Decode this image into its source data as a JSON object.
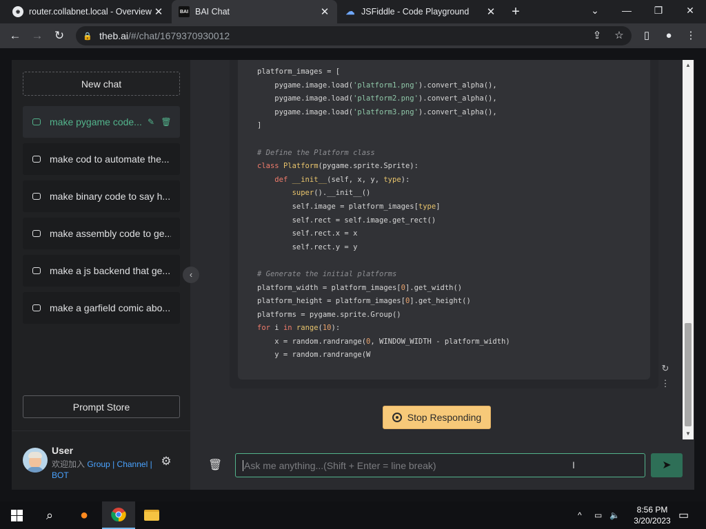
{
  "browser": {
    "tabs": [
      {
        "title": "router.collabnet.local - Overview",
        "favicon": "router-icon"
      },
      {
        "title": "BAI Chat",
        "favicon": "bai-icon",
        "favicon_text": "BAI"
      },
      {
        "title": "JSFiddle - Code Playground",
        "favicon": "jsfiddle-icon"
      }
    ],
    "url_host": "theb.ai",
    "url_path": "/#/chat/1679370930012"
  },
  "sidebar": {
    "new_chat_label": "New chat",
    "chats": [
      {
        "label": "make pygame code..."
      },
      {
        "label": "make cod to automate the..."
      },
      {
        "label": "make binary code to say h..."
      },
      {
        "label": "make assembly code to ge..."
      },
      {
        "label": "make a js backend that ge..."
      },
      {
        "label": "make a garfield comic abo..."
      }
    ],
    "prompt_store_label": "Prompt Store",
    "user": {
      "name": "User",
      "intro": "欢迎加入",
      "link_group": "Group",
      "sep": "|",
      "link_channel": "Channel",
      "link_bot": "BOT"
    }
  },
  "chat": {
    "code": [
      [
        {
          "t": "platform_images = ["
        }
      ],
      [
        {
          "t": "    pygame.image.load("
        },
        {
          "t": "'platform1.png'",
          "c": "str"
        },
        {
          "t": ").convert_alpha(),"
        }
      ],
      [
        {
          "t": "    pygame.image.load("
        },
        {
          "t": "'platform2.png'",
          "c": "str"
        },
        {
          "t": ").convert_alpha(),"
        }
      ],
      [
        {
          "t": "    pygame.image.load("
        },
        {
          "t": "'platform3.png'",
          "c": "str"
        },
        {
          "t": ").convert_alpha(),"
        }
      ],
      [
        {
          "t": "]"
        }
      ],
      [
        {
          "t": ""
        }
      ],
      [
        {
          "t": "# Define the Platform class",
          "c": "cm"
        }
      ],
      [
        {
          "t": "class ",
          "c": "kw"
        },
        {
          "t": "Platform",
          "c": "fn"
        },
        {
          "t": "(pygame.sprite.Sprite):"
        }
      ],
      [
        {
          "t": "    "
        },
        {
          "t": "def ",
          "c": "kw"
        },
        {
          "t": "__init__",
          "c": "fn"
        },
        {
          "t": "(self, x, y, "
        },
        {
          "t": "type",
          "c": "fn"
        },
        {
          "t": "):"
        }
      ],
      [
        {
          "t": "        "
        },
        {
          "t": "super",
          "c": "fn"
        },
        {
          "t": "().__init__()"
        }
      ],
      [
        {
          "t": "        self.image = platform_images["
        },
        {
          "t": "type",
          "c": "fn"
        },
        {
          "t": "]"
        }
      ],
      [
        {
          "t": "        self.rect = self.image.get_rect()"
        }
      ],
      [
        {
          "t": "        self.rect.x = x"
        }
      ],
      [
        {
          "t": "        self.rect.y = y"
        }
      ],
      [
        {
          "t": ""
        }
      ],
      [
        {
          "t": "# Generate the initial platforms",
          "c": "cm"
        }
      ],
      [
        {
          "t": "platform_width = platform_images["
        },
        {
          "t": "0",
          "c": "num"
        },
        {
          "t": "].get_width()"
        }
      ],
      [
        {
          "t": "platform_height = platform_images["
        },
        {
          "t": "0",
          "c": "num"
        },
        {
          "t": "].get_height()"
        }
      ],
      [
        {
          "t": "platforms = pygame.sprite.Group()"
        }
      ],
      [
        {
          "t": "for ",
          "c": "kw"
        },
        {
          "t": "i "
        },
        {
          "t": "in ",
          "c": "kw"
        },
        {
          "t": "range",
          "c": "fn"
        },
        {
          "t": "("
        },
        {
          "t": "10",
          "c": "num"
        },
        {
          "t": "):"
        }
      ],
      [
        {
          "t": "    x = random.randrange("
        },
        {
          "t": "0",
          "c": "num"
        },
        {
          "t": ", WINDOW_WIDTH - platform_width)"
        }
      ],
      [
        {
          "t": "    y = random.randrange(W"
        }
      ]
    ],
    "stop_label": "Stop Responding",
    "input_placeholder": "Ask me anything...(Shift + Enter = line break)"
  },
  "taskbar": {
    "time": "8:56 PM",
    "date": "3/20/2023"
  },
  "colors": {
    "accent": "#53b48c",
    "stop_button": "#f7c979",
    "link": "#4aa3ff"
  }
}
